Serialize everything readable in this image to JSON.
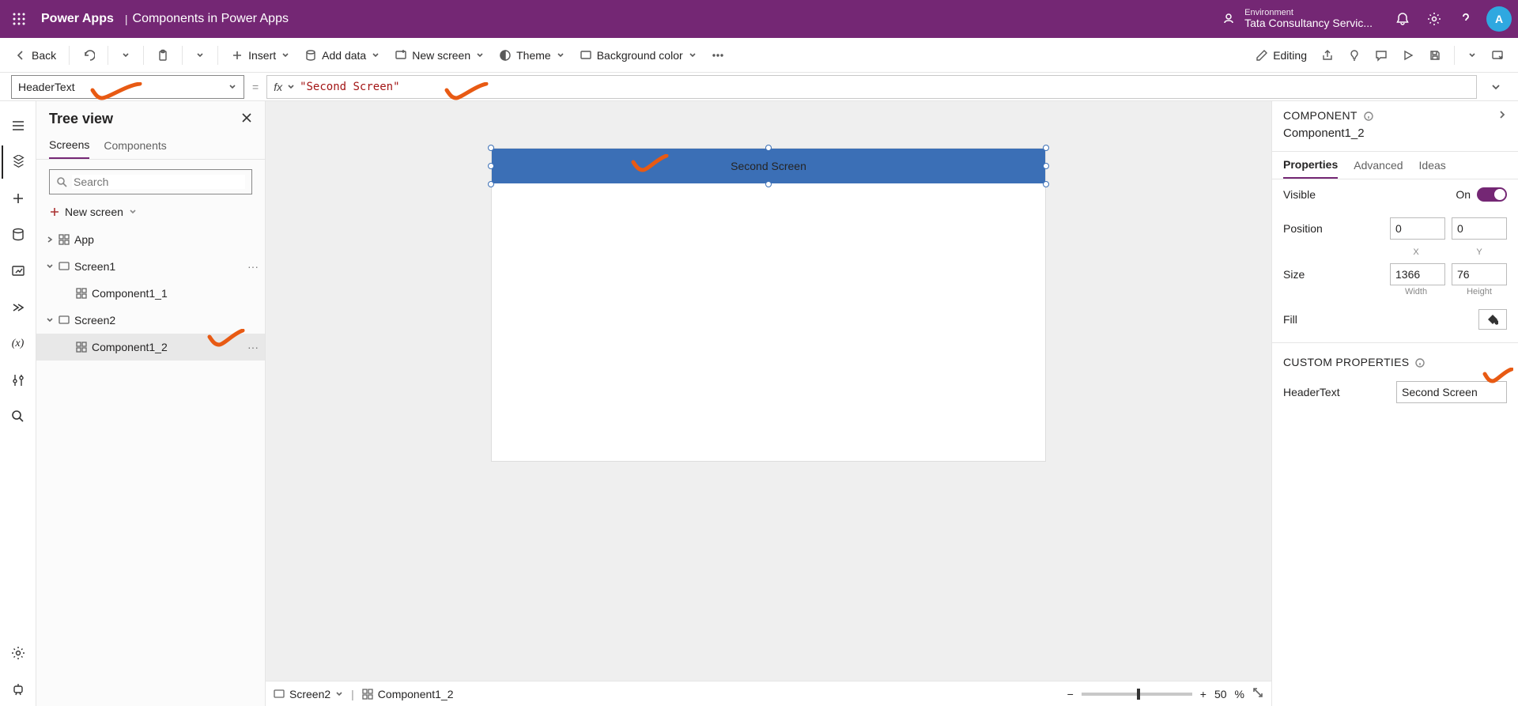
{
  "ribbon": {
    "app": "Power Apps",
    "doc": "Components in Power Apps",
    "env_label": "Environment",
    "env_name": "Tata Consultancy Servic...",
    "avatar": "A"
  },
  "cmd": {
    "back": "Back",
    "insert": "Insert",
    "add_data": "Add data",
    "new_screen": "New screen",
    "theme": "Theme",
    "bg": "Background color",
    "editing": "Editing"
  },
  "formula": {
    "prop": "HeaderText",
    "value": "\"Second Screen\""
  },
  "tree": {
    "title": "Tree view",
    "tab_screens": "Screens",
    "tab_components": "Components",
    "search_placeholder": "Search",
    "new_screen": "New screen",
    "items": {
      "app": "App",
      "screen1": "Screen1",
      "comp1_1": "Component1_1",
      "screen2": "Screen2",
      "comp1_2": "Component1_2"
    }
  },
  "canvas": {
    "header_text": "Second Screen"
  },
  "status": {
    "screen": "Screen2",
    "selected": "Component1_2",
    "zoom": "50",
    "zoom_unit": "%"
  },
  "props": {
    "section": "COMPONENT",
    "name": "Component1_2",
    "tab_props": "Properties",
    "tab_adv": "Advanced",
    "tab_ideas": "Ideas",
    "visible_label": "Visible",
    "visible_value": "On",
    "position_label": "Position",
    "x": "0",
    "y": "0",
    "x_lbl": "X",
    "y_lbl": "Y",
    "size_label": "Size",
    "w": "1366",
    "h": "76",
    "w_lbl": "Width",
    "h_lbl": "Height",
    "fill_label": "Fill",
    "custom_section": "CUSTOM PROPERTIES",
    "headertext_label": "HeaderText",
    "headertext_value": "Second Screen"
  }
}
